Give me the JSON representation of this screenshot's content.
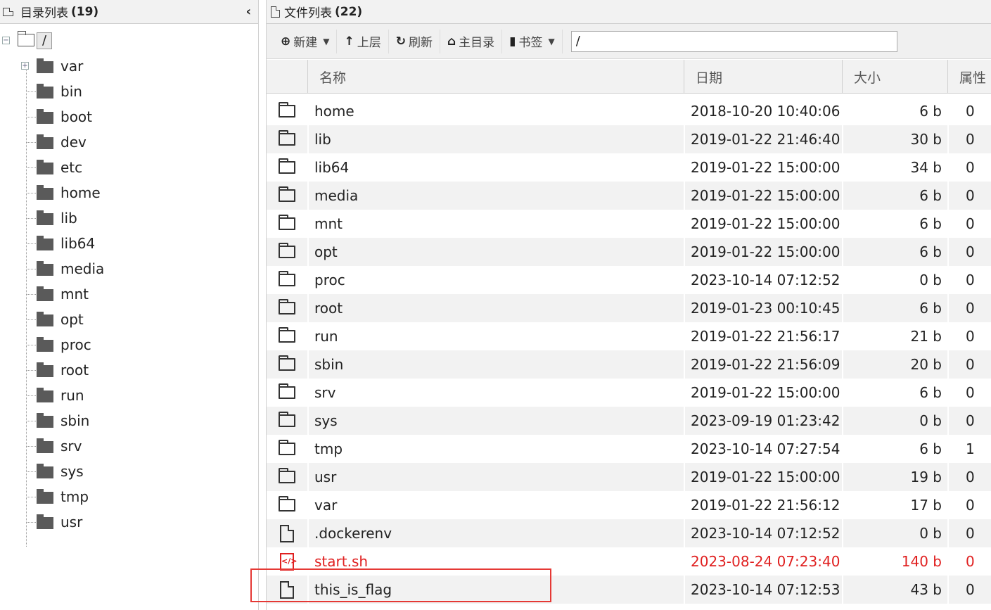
{
  "left_panel": {
    "title": "目录列表",
    "count": "(19)",
    "collapse_icon": "chevron-left-icon",
    "root_label": "/",
    "items": [
      {
        "label": "var"
      },
      {
        "label": "bin"
      },
      {
        "label": "boot"
      },
      {
        "label": "dev"
      },
      {
        "label": "etc"
      },
      {
        "label": "home"
      },
      {
        "label": "lib"
      },
      {
        "label": "lib64"
      },
      {
        "label": "media"
      },
      {
        "label": "mnt"
      },
      {
        "label": "opt"
      },
      {
        "label": "proc"
      },
      {
        "label": "root"
      },
      {
        "label": "run"
      },
      {
        "label": "sbin"
      },
      {
        "label": "srv"
      },
      {
        "label": "sys"
      },
      {
        "label": "tmp"
      },
      {
        "label": "usr"
      }
    ]
  },
  "right_panel": {
    "title": "文件列表",
    "count": "(22)",
    "toolbar": {
      "new_label": "新建",
      "up_label": "上层",
      "refresh_label": "刷新",
      "home_label": "主目录",
      "bookmark_label": "书签",
      "path_value": "/"
    },
    "columns": {
      "name": "名称",
      "date": "日期",
      "size": "大小",
      "attr": "属性"
    },
    "rows": [
      {
        "type": "folder",
        "name": "home",
        "date": "2018-10-20 10:40:06",
        "size": "6 b",
        "attr": "0"
      },
      {
        "type": "folder",
        "name": "lib",
        "date": "2019-01-22 21:46:40",
        "size": "30 b",
        "attr": "0"
      },
      {
        "type": "folder",
        "name": "lib64",
        "date": "2019-01-22 15:00:00",
        "size": "34 b",
        "attr": "0"
      },
      {
        "type": "folder",
        "name": "media",
        "date": "2019-01-22 15:00:00",
        "size": "6 b",
        "attr": "0"
      },
      {
        "type": "folder",
        "name": "mnt",
        "date": "2019-01-22 15:00:00",
        "size": "6 b",
        "attr": "0"
      },
      {
        "type": "folder",
        "name": "opt",
        "date": "2019-01-22 15:00:00",
        "size": "6 b",
        "attr": "0"
      },
      {
        "type": "folder",
        "name": "proc",
        "date": "2023-10-14 07:12:52",
        "size": "0 b",
        "attr": "0"
      },
      {
        "type": "folder",
        "name": "root",
        "date": "2019-01-23 00:10:45",
        "size": "6 b",
        "attr": "0"
      },
      {
        "type": "folder",
        "name": "run",
        "date": "2019-01-22 21:56:17",
        "size": "21 b",
        "attr": "0"
      },
      {
        "type": "folder",
        "name": "sbin",
        "date": "2019-01-22 21:56:09",
        "size": "20 b",
        "attr": "0"
      },
      {
        "type": "folder",
        "name": "srv",
        "date": "2019-01-22 15:00:00",
        "size": "6 b",
        "attr": "0"
      },
      {
        "type": "folder",
        "name": "sys",
        "date": "2023-09-19 01:23:42",
        "size": "0 b",
        "attr": "0"
      },
      {
        "type": "folder",
        "name": "tmp",
        "date": "2023-10-14 07:27:54",
        "size": "6 b",
        "attr": "1"
      },
      {
        "type": "folder",
        "name": "usr",
        "date": "2019-01-22 15:00:00",
        "size": "19 b",
        "attr": "0"
      },
      {
        "type": "folder",
        "name": "var",
        "date": "2019-01-22 21:56:12",
        "size": "17 b",
        "attr": "0"
      },
      {
        "type": "file",
        "name": ".dockerenv",
        "date": "2023-10-14 07:12:52",
        "size": "0 b",
        "attr": "0"
      },
      {
        "type": "script",
        "name": "start.sh",
        "date": "2023-08-24 07:23:40",
        "size": "140 b",
        "attr": "0"
      },
      {
        "type": "file",
        "name": "this_is_flag",
        "date": "2023-10-14 07:12:53",
        "size": "43 b",
        "attr": "0"
      }
    ]
  },
  "colors": {
    "highlight": "#e53935",
    "script_text": "#e02020"
  }
}
